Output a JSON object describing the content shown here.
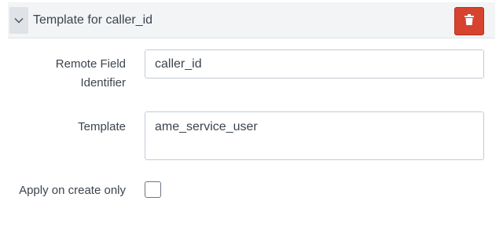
{
  "header": {
    "title": "Template for caller_id",
    "collapse_icon": "chevron-down-icon",
    "delete_icon": "trash-icon"
  },
  "form": {
    "remote_field": {
      "label": "Remote Field Identifier",
      "value": "caller_id"
    },
    "template": {
      "label": "Template",
      "value": "ame_service_user"
    },
    "apply_on_create": {
      "label": "Apply on create only",
      "checked": false
    }
  },
  "colors": {
    "header_bg": "#f2f4f5",
    "delete_bg": "#d6432f",
    "text": "#3c444d"
  }
}
